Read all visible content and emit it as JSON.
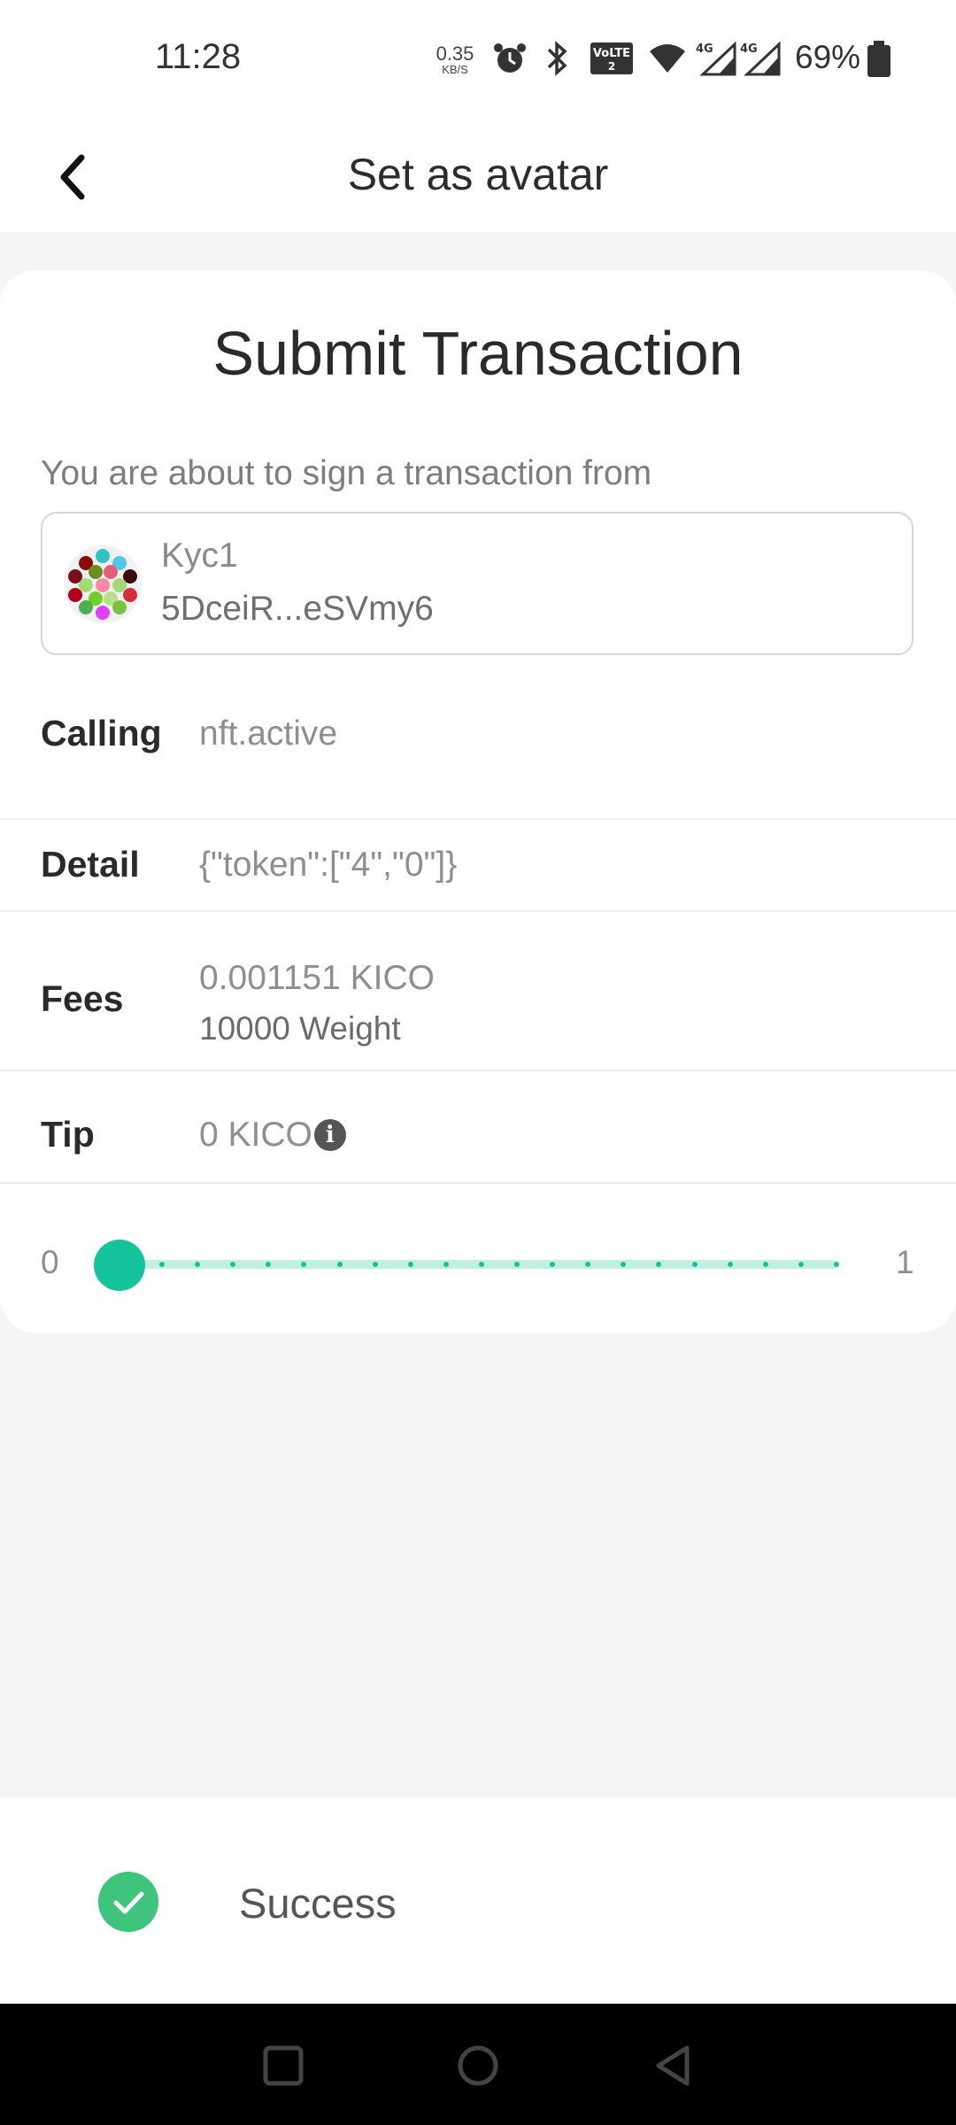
{
  "status_bar": {
    "time": "11:28",
    "net_speed_value": "0.35",
    "net_speed_unit": "KB/S",
    "battery_percent": "69%",
    "icons": [
      "alarm-icon",
      "bluetooth-icon",
      "volte-icon",
      "wifi-icon",
      "signal-4g-icon",
      "signal-4g-icon",
      "battery-icon"
    ]
  },
  "app_bar": {
    "title": "Set as avatar",
    "back_icon": "chevron-left-icon"
  },
  "transaction": {
    "title": "Submit Transaction",
    "intro": "You are about to sign a transaction from",
    "account": {
      "name": "Kyc1",
      "address": "5DceiR...eSVmy6"
    },
    "calling": {
      "label": "Calling",
      "value": "nft.active"
    },
    "detail": {
      "label": "Detail",
      "value": "{\"token\":[\"4\",\"0\"]}"
    },
    "fees": {
      "label": "Fees",
      "value": "0.001151 KICO",
      "weight": "10000 Weight"
    },
    "tip": {
      "label": "Tip",
      "value": "0 KICO",
      "info_icon": "info-icon"
    },
    "slider": {
      "min": "0",
      "max": "1",
      "level": 0
    }
  },
  "toast": {
    "text": "Success",
    "icon": "check-circle-icon",
    "icon_color": "#3ec47c"
  },
  "colors": {
    "accent": "#14c39a",
    "track": "#bff0e2",
    "background": "#f4f5f7"
  },
  "nav_bar": {
    "icons": [
      "recent-apps-icon",
      "home-icon",
      "back-icon"
    ]
  }
}
